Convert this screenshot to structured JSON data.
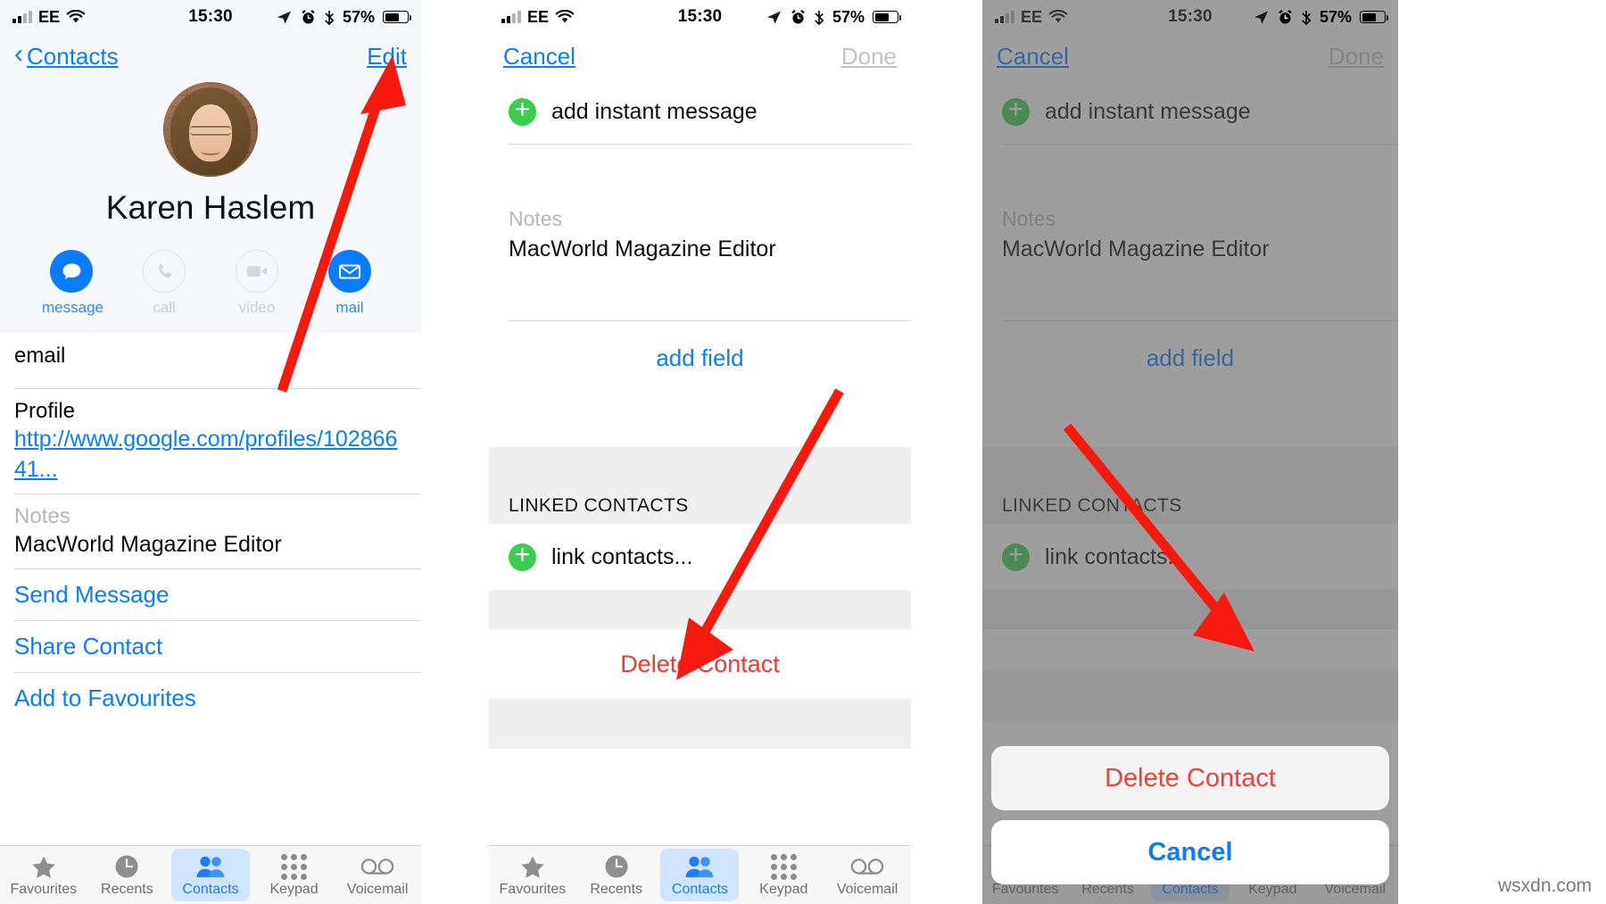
{
  "status_bar": {
    "carrier": "EE",
    "time": "15:30",
    "battery_pct": "57%",
    "icons": [
      "signal-bars-icon",
      "wifi-icon",
      "location-arrow-icon",
      "alarm-clock-icon",
      "bluetooth-icon",
      "battery-icon"
    ]
  },
  "colors": {
    "accent_blue": "#0a7cff",
    "destructive_red": "#ee3b2f",
    "add_green": "#3ccc52",
    "annotation_red": "#f61a0e",
    "tab_active_bg": "#cfe4fd"
  },
  "tabs": [
    {
      "label": "Favourites",
      "icon": "star-icon",
      "active": false
    },
    {
      "label": "Recents",
      "icon": "clock-icon",
      "active": false
    },
    {
      "label": "Contacts",
      "icon": "people-icon",
      "active": true
    },
    {
      "label": "Keypad",
      "icon": "keypad-dots-icon",
      "active": false
    },
    {
      "label": "Voicemail",
      "icon": "voicemail-icon",
      "active": false
    }
  ],
  "panel1": {
    "nav": {
      "back_label": "Contacts",
      "right_label": "Edit"
    },
    "contact_name": "Karen Haslem",
    "avatar_alt": "contact-photo",
    "quick_actions": [
      {
        "label": "message",
        "icon": "message-bubble-icon",
        "enabled": true
      },
      {
        "label": "call",
        "icon": "phone-icon",
        "enabled": false
      },
      {
        "label": "video",
        "icon": "video-camera-icon",
        "enabled": false
      },
      {
        "label": "mail",
        "icon": "envelope-icon",
        "enabled": true
      }
    ],
    "fields": [
      {
        "label": "email",
        "value": ""
      },
      {
        "label": "Profile",
        "value": "http://www.google.com/profiles/10286641...",
        "is_link": true
      },
      {
        "label": "Notes",
        "value": "MacWorld Magazine Editor",
        "label_grey": true
      }
    ],
    "link_actions": [
      "Send Message",
      "Share Contact",
      "Add to Favourites"
    ]
  },
  "panel2": {
    "nav": {
      "left_label": "Cancel",
      "right_label": "Done"
    },
    "add_instant_message": "add instant message",
    "notes": {
      "label": "Notes",
      "value": "MacWorld Magazine Editor"
    },
    "add_field": "add field",
    "linked_contacts_header": "LINKED CONTACTS",
    "link_contacts": "link contacts...",
    "delete_contact": "Delete Contact"
  },
  "panel3": {
    "nav": {
      "left_label": "Cancel",
      "right_label": "Done"
    },
    "add_instant_message": "add instant message",
    "notes": {
      "label": "Notes",
      "value": "MacWorld Magazine Editor"
    },
    "add_field": "add field",
    "linked_contacts_header": "LINKED CONTACTS",
    "link_contacts": "link contacts...",
    "action_sheet": {
      "destructive_label": "Delete Contact",
      "cancel_label": "Cancel"
    }
  },
  "annotations": [
    {
      "name": "arrow-to-edit-button",
      "target": "Edit"
    },
    {
      "name": "arrow-to-delete-contact",
      "target": "Delete Contact"
    },
    {
      "name": "arrow-to-delete-contact-sheet",
      "target": "Delete Contact"
    }
  ],
  "watermark": "wsxdn.com"
}
